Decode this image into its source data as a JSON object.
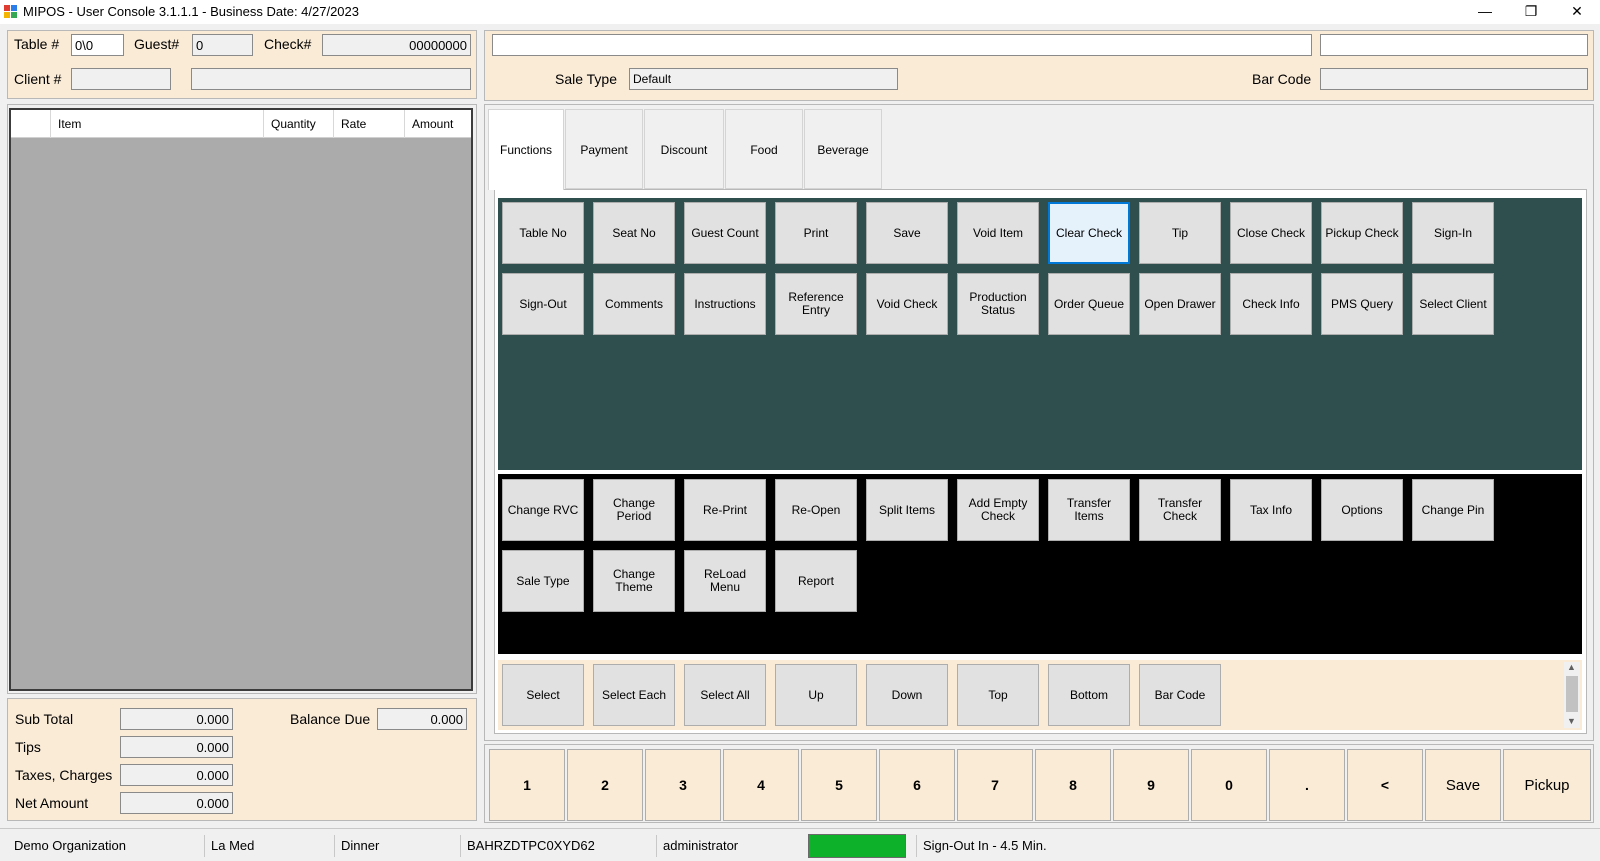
{
  "window": {
    "title": "MIPOS - User Console 3.1.1.1 - Business Date: 4/27/2023",
    "minimize": "—",
    "restore": "❐",
    "close": "✕"
  },
  "header": {
    "table_label": "Table #",
    "table_value": "0\\0",
    "guest_label": "Guest#",
    "guest_value": "0",
    "check_label": "Check#",
    "check_value": "00000000",
    "client_label": "Client #",
    "client_id_value": "",
    "client_name_value": ""
  },
  "grid": {
    "columns": [
      "",
      "Item",
      "Quantity",
      "Rate",
      "Amount"
    ]
  },
  "totals": {
    "subtotal_label": "Sub Total",
    "subtotal_value": "0.000",
    "tips_label": "Tips",
    "tips_value": "0.000",
    "taxes_label": "Taxes, Charges",
    "taxes_value": "0.000",
    "net_label": "Net Amount",
    "net_value": "0.000",
    "balance_label": "Balance Due",
    "balance_value": "0.000"
  },
  "top": {
    "search_value": "",
    "search2_value": "",
    "sale_type_label": "Sale Type",
    "sale_type_value": "Default",
    "barcode_label": "Bar Code",
    "barcode_value": ""
  },
  "tabs": [
    "Functions",
    "Payment",
    "Discount",
    "Food",
    "Beverage"
  ],
  "functions_row1": [
    "Table No",
    "Seat No",
    "Guest Count",
    "Print",
    "Save",
    "Void Item",
    "Clear Check",
    "Tip",
    "Close Check",
    "Pickup Check",
    "Sign-In"
  ],
  "functions_row2": [
    "Sign-Out",
    "Comments",
    "Instructions",
    "Reference Entry",
    "Void Check",
    "Production Status",
    "Order Queue",
    "Open Drawer",
    "Check Info",
    "PMS Query",
    "Select Client"
  ],
  "admin_row1": [
    "Change RVC",
    "Change Period",
    "Re-Print",
    "Re-Open",
    "Split Items",
    "Add Empty Check",
    "Transfer Items",
    "Transfer Check",
    "Tax Info",
    "Options",
    "Change  Pin"
  ],
  "admin_row2": [
    "Sale Type",
    "Change Theme",
    "ReLoad Menu",
    "Report"
  ],
  "selection": [
    "Select",
    "Select Each",
    "Select All",
    "Up",
    "Down",
    "Top",
    "Bottom",
    "Bar Code"
  ],
  "keypad": [
    "1",
    "2",
    "3",
    "4",
    "5",
    "6",
    "7",
    "8",
    "9",
    "0",
    ".",
    "<",
    "Save",
    "Pickup"
  ],
  "status": {
    "organization": "Demo Organization",
    "outlet": "La Med",
    "period": "Dinner",
    "terminal": "BAHRZDTPC0XYD62",
    "user": "administrator",
    "indicator_color": "#0db22a",
    "signout": "Sign-Out In - 4.5 Min."
  },
  "colors": {
    "functions_bg": "#2f4f4f",
    "admin_bg": "#000000",
    "peach": "#faebd7",
    "highlight_border": "#0078d7"
  }
}
